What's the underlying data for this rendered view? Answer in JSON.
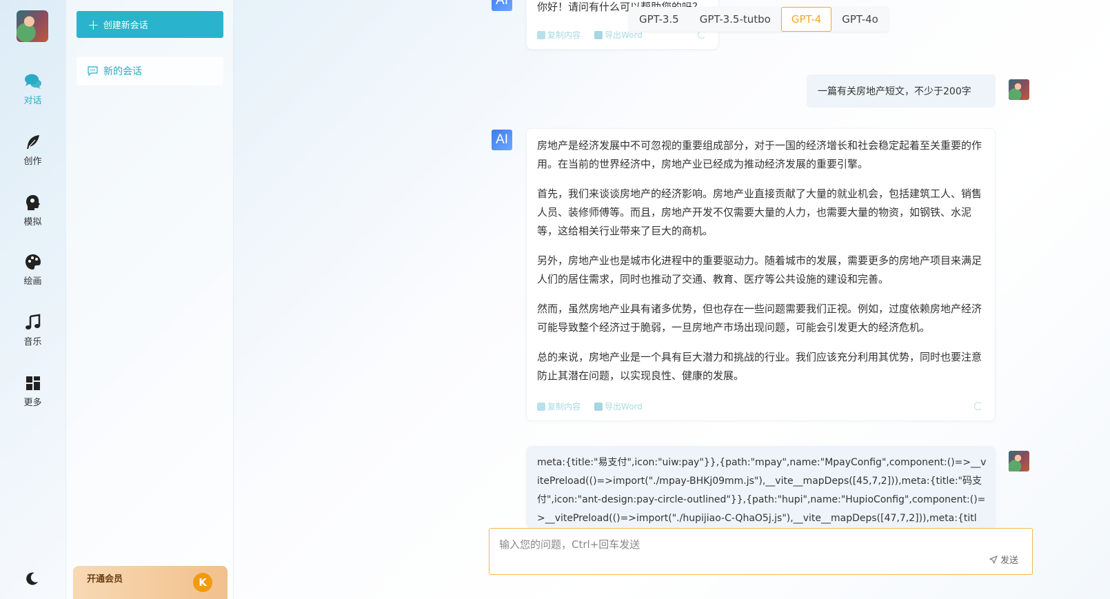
{
  "nav": {
    "items": [
      {
        "label": "对话",
        "icon": "chat-icon"
      },
      {
        "label": "创作",
        "icon": "feather-icon"
      },
      {
        "label": "模拟",
        "icon": "head-icon"
      },
      {
        "label": "绘画",
        "icon": "palette-icon"
      },
      {
        "label": "音乐",
        "icon": "music-icon"
      },
      {
        "label": "更多",
        "icon": "grid-icon"
      }
    ],
    "active_color": "#29abc4"
  },
  "sidebar": {
    "new_chat_label": "创建新会话",
    "sessions": [
      {
        "label": "新的会话"
      }
    ],
    "vip_label": "开通会员",
    "vip_coin": "K"
  },
  "models": {
    "options": [
      "GPT-3.5",
      "GPT-3.5-tutbo",
      "GPT-4",
      "GPT-4o"
    ],
    "selected": "GPT-4",
    "accent": "#f5a623"
  },
  "messages": {
    "first_ai_text": "你好！请问有什么可以帮助您的吗？",
    "user_prompt": "一篇有关房地产短文，不少于200字",
    "ai_paragraphs": [
      "房地产是经济发展中不可忽视的重要组成部分，对于一国的经济增长和社会稳定起着至关重要的作用。在当前的世界经济中，房地产业已经成为推动经济发展的重要引擎。",
      "首先，我们来谈谈房地产的经济影响。房地产业直接贡献了大量的就业机会，包括建筑工人、销售人员、装修师傅等。而且，房地产开发不仅需要大量的人力，也需要大量的物资，如钢铁、水泥等，这给相关行业带来了巨大的商机。",
      "另外，房地产业也是城市化进程中的重要驱动力。随着城市的发展，需要更多的房地产项目来满足人们的居住需求，同时也推动了交通、教育、医疗等公共设施的建设和完善。",
      "然而，虽然房地产业具有诸多优势，但也存在一些问题需要我们正视。例如，过度依赖房地产经济可能导致整个经济过于脆弱，一旦房地产市场出现问题，可能会引发更大的经济危机。",
      "总的来说，房地产业是一个具有巨大潜力和挑战的行业。我们应该充分利用其优势，同时也要注意防止其潜在问题，以实现良性、健康的发展。"
    ],
    "user_code": "meta:{title:\"易支付\",icon:\"uiw:pay\"}},{path:\"mpay\",name:\"MpayConfig\",component:()=>__vitePreload(()=>import(\"./mpay-BHKj09mm.js\"),__vite__mapDeps([45,7,2])),meta:{title:\"码支付\",icon:\"ant-design:pay-circle-outlined\"}},{path:\"hupi\",name:\"HupioConfig\",component:()=>__vitePreload(()=>import(\"./hupijiao-C-QhaO5j.js\"),__vite__mapDeps([47,7,2])),meta:{title:\"虎皮椒支付\",ic"
  },
  "tools": {
    "copy_label": "复制内容",
    "word_label": "导出Word"
  },
  "input": {
    "placeholder": "输入您的问题，Ctrl+回车发送",
    "send_label": "发送"
  }
}
